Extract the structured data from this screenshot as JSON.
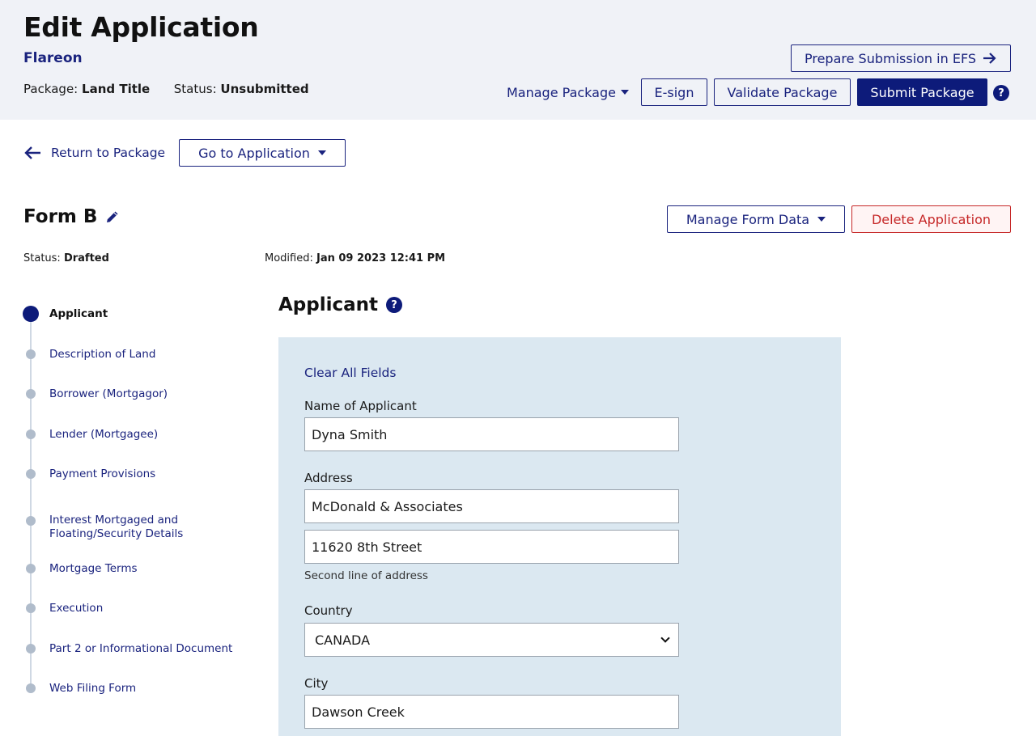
{
  "header": {
    "title": "Edit Application",
    "org": "Flareon",
    "package_label": "Package:",
    "package_value": "Land Title",
    "status_label": "Status:",
    "status_value": "Unsubmitted",
    "prepare_label": "Prepare Submission in EFS",
    "manage_package_label": "Manage Package",
    "esign_label": "E-sign",
    "validate_label": "Validate Package",
    "submit_label": "Submit Package",
    "help_glyph": "?"
  },
  "nav": {
    "return_label": "Return to Package",
    "goto_label": "Go to Application"
  },
  "form": {
    "title": "Form B",
    "manage_data_label": "Manage Form Data",
    "delete_label": "Delete Application",
    "status_label": "Status:",
    "status_value": "Drafted",
    "modified_label": "Modified:",
    "modified_value": "Jan 09 2023 12:41 PM"
  },
  "steps": [
    {
      "label": "Applicant",
      "active": true
    },
    {
      "label": "Description of Land",
      "active": false
    },
    {
      "label": "Borrower (Mortgagor)",
      "active": false
    },
    {
      "label": "Lender (Mortgagee)",
      "active": false
    },
    {
      "label": "Payment Provisions",
      "active": false
    },
    {
      "label": "Interest Mortgaged and Floating/Security Details",
      "active": false
    },
    {
      "label": "Mortgage Terms",
      "active": false
    },
    {
      "label": "Execution",
      "active": false
    },
    {
      "label": "Part 2 or Informational Document",
      "active": false
    },
    {
      "label": "Web Filing Form",
      "active": false
    }
  ],
  "section": {
    "title": "Applicant",
    "clear_label": "Clear All Fields",
    "name_label": "Name of Applicant",
    "name_value": "Dyna Smith",
    "address_label": "Address",
    "address_line1": "McDonald & Associates",
    "address_line2": "11620 8th Street",
    "address_help": "Second line of address",
    "country_label": "Country",
    "country_value": "CANADA",
    "city_label": "City",
    "city_value": "Dawson Creek"
  },
  "colors": {
    "accent": "#1a237e",
    "primary_button": "#0d1b7a",
    "header_bg": "#f0f2f7",
    "panel_bg": "#dbe8f1",
    "danger": "#c62828"
  }
}
